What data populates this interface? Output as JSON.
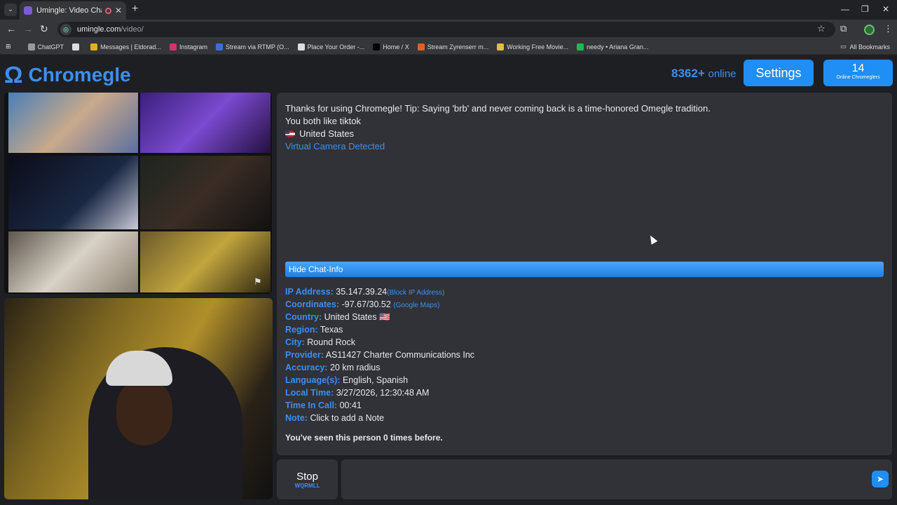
{
  "browser": {
    "tab_title": "Umingle: Video Chat with S",
    "url_domain": "umingle.com",
    "url_path": "/video/",
    "bookmarks": [
      {
        "label": "ChatGPT",
        "color": "#999999"
      },
      {
        "label": "",
        "color": "#dddddd"
      },
      {
        "label": "Messages | Eldorad...",
        "color": "#e0b020"
      },
      {
        "label": "Instagram",
        "color": "#d6336c"
      },
      {
        "label": "Stream via RTMP (O...",
        "color": "#3b6fd8"
      },
      {
        "label": "Place Your Order -...",
        "color": "#dddddd"
      },
      {
        "label": "Home / X",
        "color": "#000000"
      },
      {
        "label": "Stream Zyrenserr m...",
        "color": "#e06020"
      },
      {
        "label": "Working Free Movie...",
        "color": "#e0c040"
      },
      {
        "label": "needy • Ariana Gran...",
        "color": "#1db954"
      }
    ],
    "all_bookmarks": "All Bookmarks"
  },
  "header": {
    "logo": "Chromegle",
    "online_count": "8362+",
    "online_label": "online",
    "settings_label": "Settings",
    "chromeglers_count": "14",
    "chromeglers_label": "Online Chromeglers"
  },
  "chat": {
    "tip": "Thanks for using Chromegle! Tip: Saying 'brb' and never coming back is a time-honored Omegle tradition.",
    "common": "You both like tiktok",
    "country_line": "United States",
    "camera_notice": "Virtual Camera Detected",
    "hide_label": "Hide Chat-Info"
  },
  "info": {
    "ip_key": "IP Address:",
    "ip_val": "35.147.39.24",
    "ip_action": "(Block IP Address)",
    "coord_key": "Coordinates:",
    "coord_val": "-97.67/30.52",
    "coord_action": "(Google Maps)",
    "country_key": "Country:",
    "country_val": "United States 🇺🇸",
    "region_key": "Region:",
    "region_val": "Texas",
    "city_key": "City:",
    "city_val": "Round Rock",
    "provider_key": "Provider:",
    "provider_val": "AS11427 Charter Communications Inc",
    "accuracy_key": "Accuracy:",
    "accuracy_val": "20 km radius",
    "lang_key": "Language(s):",
    "lang_val": "English, Spanish",
    "time_key": "Local Time:",
    "time_val": "3/27/2026, 12:30:48 AM",
    "call_key": "Time In Call:",
    "call_val": "00:41",
    "note_key": "Note:",
    "note_val": "Click to add a Note",
    "seen": "You've seen this person 0 times before."
  },
  "controls": {
    "stop_label": "Stop",
    "stop_key": "WQRMLL",
    "message_placeholder": ""
  },
  "colors": {
    "accent": "#1f8ef5",
    "link": "#3d8ff0",
    "panel": "#303238"
  }
}
